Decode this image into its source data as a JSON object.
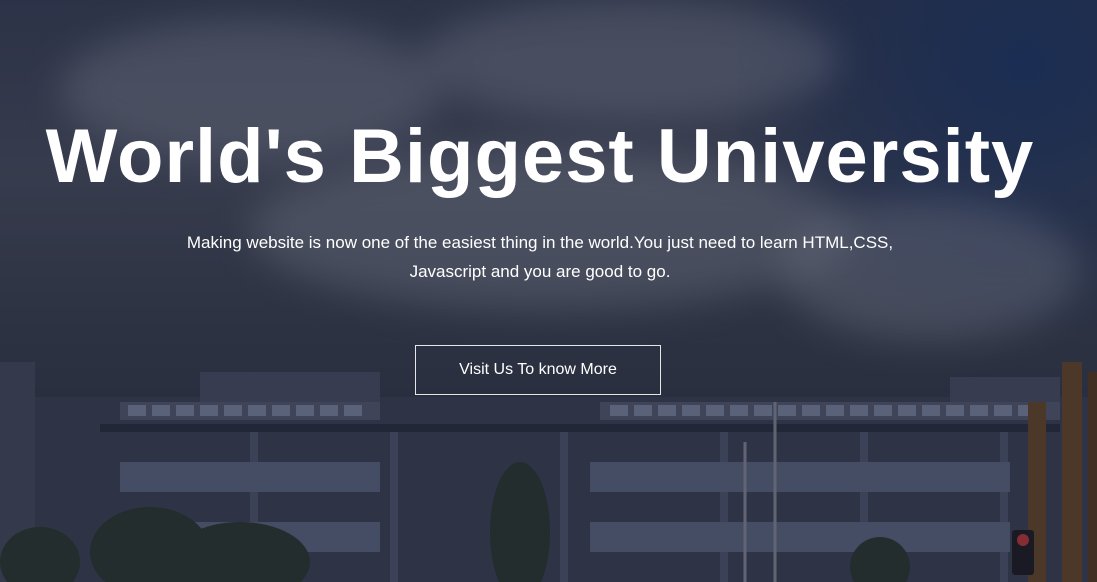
{
  "hero": {
    "title": "World's Biggest University",
    "subtitle": "Making website is now one of the easiest thing in the world.You just need to learn HTML,CSS, Javascript and you are good to go.",
    "cta_label": "Visit Us To know More"
  }
}
